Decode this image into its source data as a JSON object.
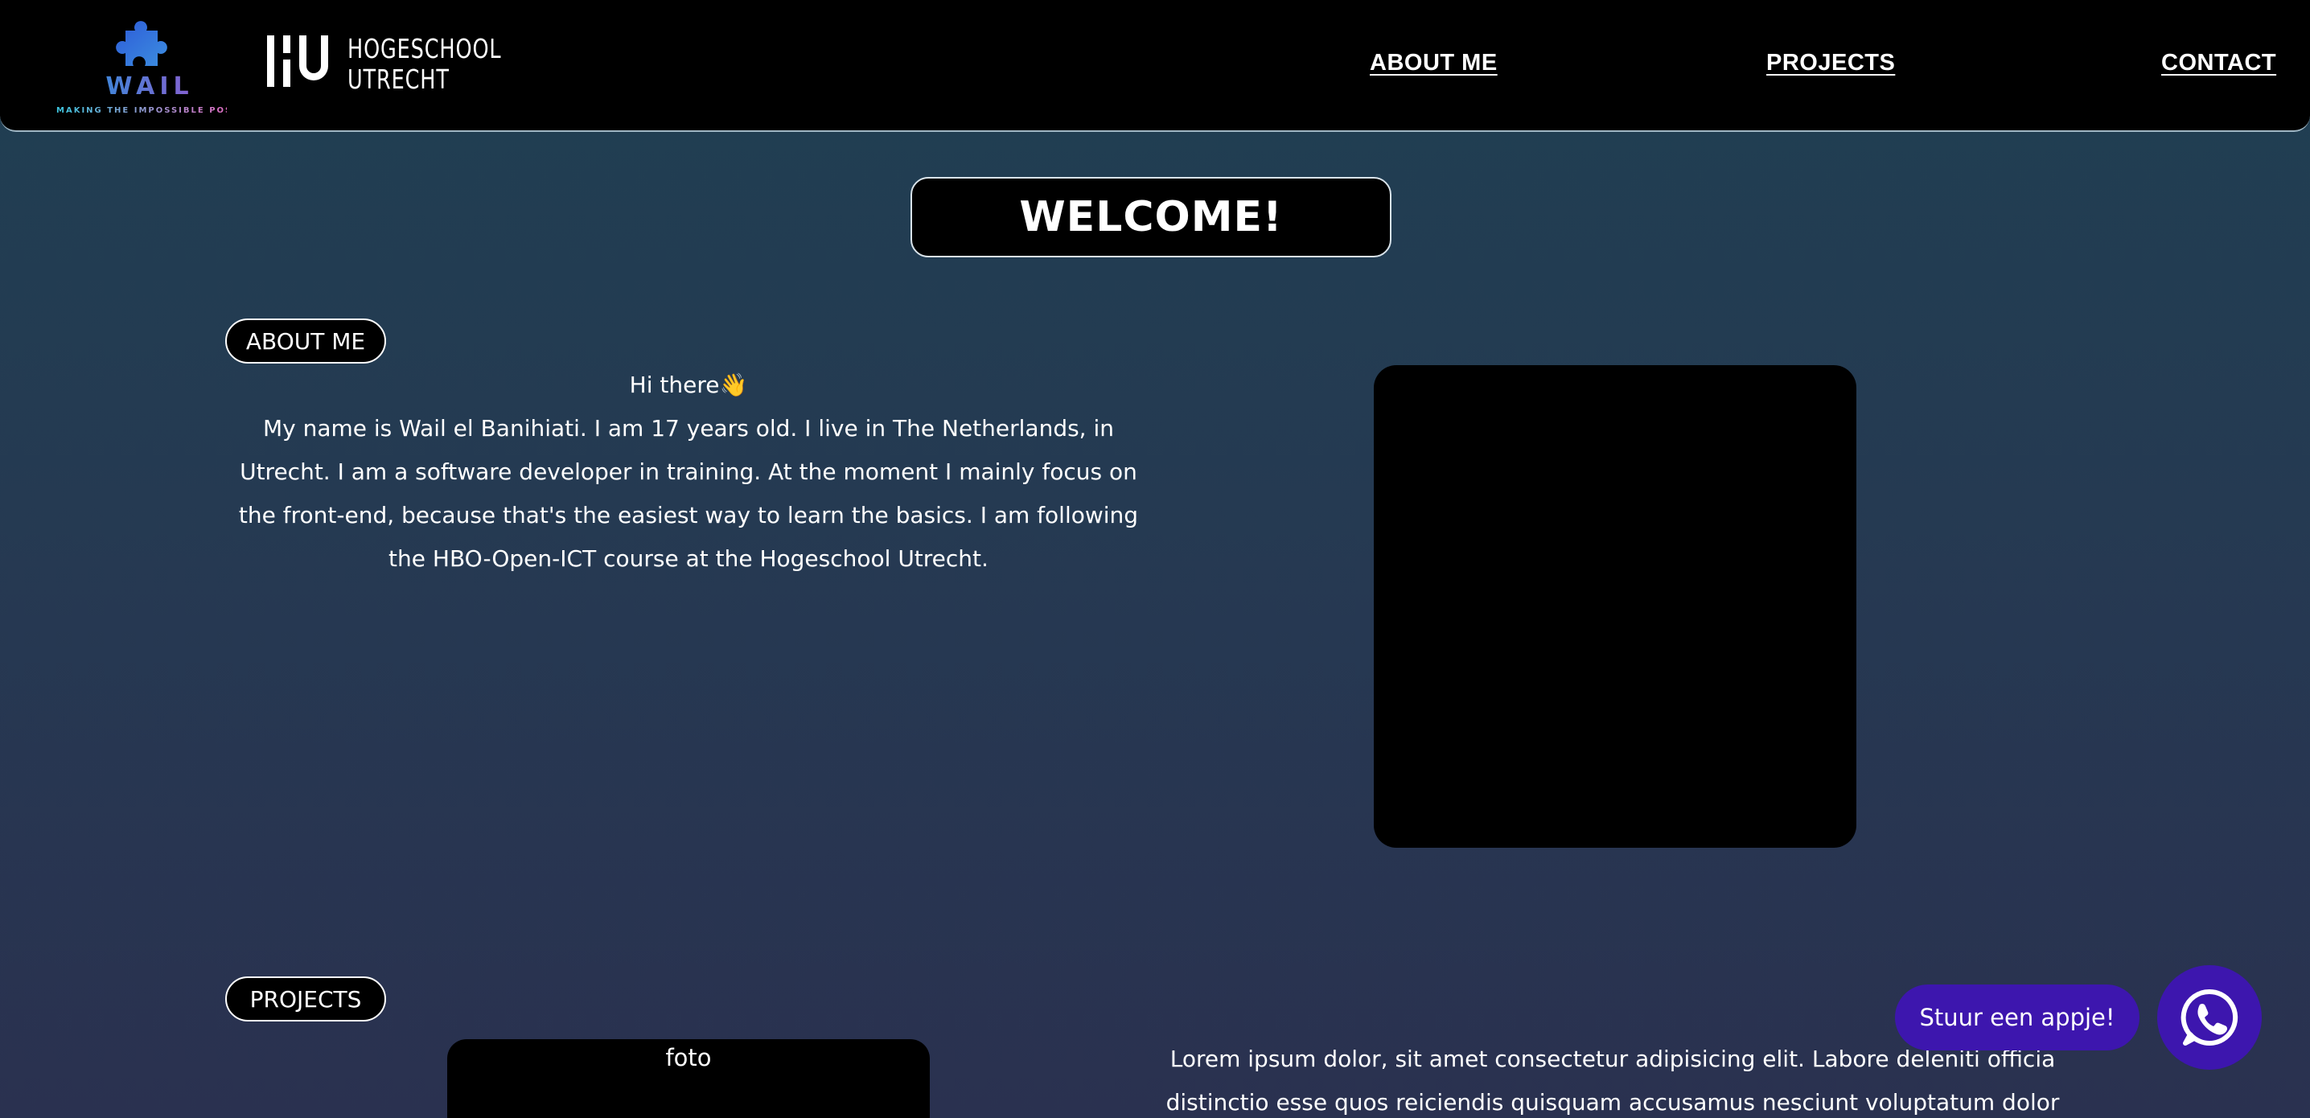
{
  "nav": {
    "logo_name": "WAIL",
    "logo_tagline": "MAKING THE IMPOSSIBLE POSSIBLE",
    "school_line1": "HOGESCHOOL",
    "school_line2": "UTRECHT",
    "links": [
      {
        "label": "ABOUT ME"
      },
      {
        "label": "PROJECTS"
      },
      {
        "label": "CONTACT"
      }
    ]
  },
  "welcome": {
    "title": "WELCOME!"
  },
  "about": {
    "heading": "ABOUT ME",
    "greeting": "Hi there👋",
    "body": "My name is Wail el Banihiati. I am 17 years old. I live in The Netherlands, in Utrecht. I am a software developer in training. At the moment I mainly focus on the front-end, because that's the easiest way to learn the basics. I am following the HBO-Open-ICT course at the Hogeschool Utrecht."
  },
  "projects": {
    "heading": "PROJECTS",
    "photo_label": "foto",
    "description": "Lorem ipsum dolor, sit amet consectetur adipisicing elit. Labore deleniti officia distinctio esse quos reiciendis quisquam accusamus nesciunt voluptatum dolor"
  },
  "whatsapp": {
    "label": "Stuur een appje!",
    "icon": "whatsapp-icon"
  },
  "colors": {
    "accent": "#3d16ae",
    "navbar": "#000000",
    "bg_top": "#1f3f52",
    "bg_bottom": "#2a3150"
  }
}
